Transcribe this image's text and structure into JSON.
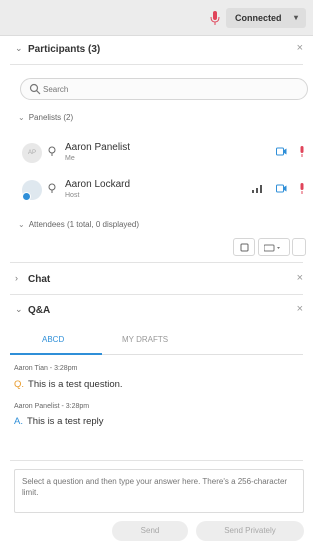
{
  "header": {
    "connection_label": "Connected",
    "connection_caret": "▾"
  },
  "participants": {
    "title": "Participants (3)",
    "close": "×",
    "search_placeholder": "Search",
    "panelists_heading": "Panelists (2)",
    "panelists": [
      {
        "name": "Aaron Panelist",
        "role": "Me",
        "avatar_text": "AP"
      },
      {
        "name": "Aaron Lockard",
        "role": "Host"
      }
    ],
    "attendees_heading": "Attendees (1 total, 0 displayed)"
  },
  "chat": {
    "title": "Chat",
    "close": "×"
  },
  "qa": {
    "title": "Q&A",
    "close": "×",
    "tabs": [
      {
        "label": "ABCD"
      },
      {
        "label": "MY DRAFTS"
      }
    ],
    "question": {
      "meta": "Aaron Tian - 3:28pm",
      "prefix": "Q.",
      "text": "This is a test question."
    },
    "answer": {
      "meta": "Aaron Panelist - 3:28pm",
      "prefix": "A.",
      "text": "This is a test reply"
    },
    "input_placeholder": "Select a question and then type your answer here. There's a 256-character limit.",
    "send_label": "Send",
    "send_privately_label": "Send Privately"
  },
  "colors": {
    "accent": "#2f8fd8",
    "mic_muted": "#e0445a",
    "question_orange": "#e89a2a"
  },
  "icons": [
    "microphone-icon",
    "search-icon",
    "pin-icon",
    "camera-icon",
    "signal-bars-icon",
    "raise-hand-icon",
    "more-icon"
  ]
}
